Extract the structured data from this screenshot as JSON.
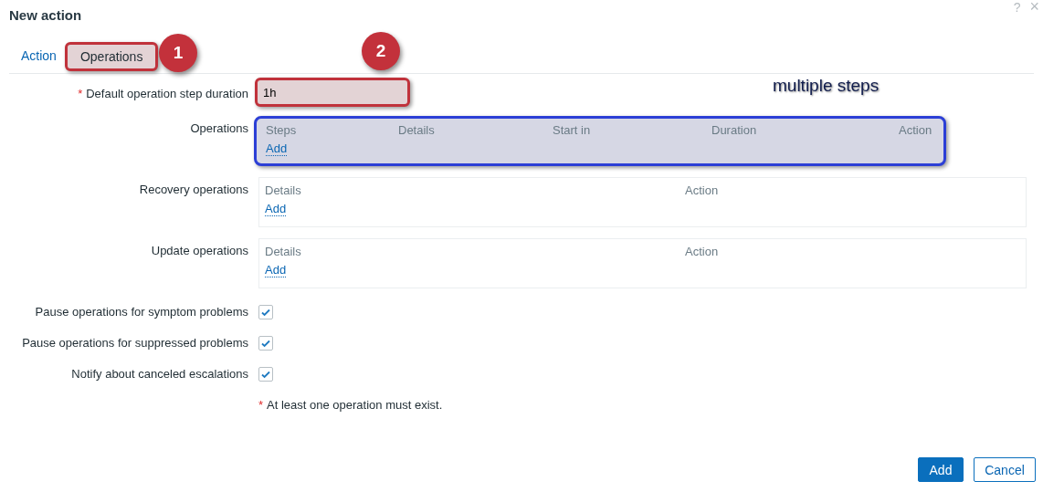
{
  "window": {
    "title": "New action",
    "help": "?",
    "close": "×"
  },
  "tabs": [
    {
      "label": "Action",
      "selected": false,
      "highlighted": false
    },
    {
      "label": "Operations",
      "selected": true,
      "highlighted": true
    }
  ],
  "step_duration": {
    "required_mark": "*",
    "label": "Default operation step duration",
    "value": "1h",
    "highlighted": true
  },
  "operation_tables": [
    {
      "label": "Operations",
      "columns": [
        "Steps",
        "Details",
        "Start in",
        "Duration",
        "Action"
      ],
      "add_link": "Add",
      "highlighted": true
    },
    {
      "label": "Recovery operations",
      "columns": [
        "Details",
        "Action"
      ],
      "add_link": "Add",
      "highlighted": false
    },
    {
      "label": "Update operations",
      "columns": [
        "Details",
        "Action"
      ],
      "add_link": "Add",
      "highlighted": false
    }
  ],
  "checkboxes": [
    {
      "label": "Pause operations for symptom problems",
      "checked": true
    },
    {
      "label": "Pause operations for suppressed problems",
      "checked": true
    },
    {
      "label": "Notify about canceled escalations",
      "checked": true
    }
  ],
  "note": {
    "mark": "*",
    "text": "At least one operation must exist."
  },
  "callouts": [
    {
      "number": "1"
    },
    {
      "number": "2"
    }
  ],
  "annotation": "multiple steps",
  "buttons": [
    {
      "label": "Add",
      "kind": "primary"
    },
    {
      "label": "Cancel",
      "kind": "secondary"
    }
  ]
}
